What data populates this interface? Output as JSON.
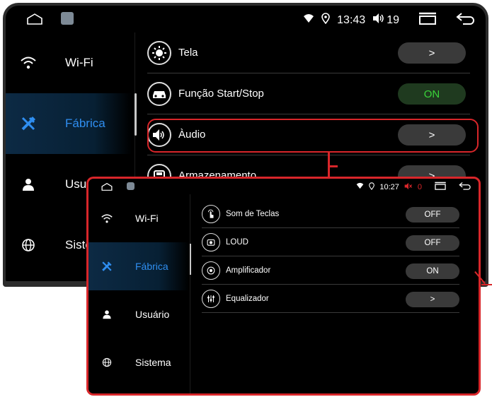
{
  "main": {
    "status": {
      "time": "13:43",
      "volume": "19"
    },
    "sidebar": [
      {
        "label": "Wi-Fi",
        "icon": "wifi-icon"
      },
      {
        "label": "Fábrica",
        "icon": "tools-icon",
        "active": true
      },
      {
        "label": "Usuário",
        "icon": "user-icon"
      },
      {
        "label": "Siste",
        "icon": "globe-icon"
      }
    ],
    "rows": [
      {
        "label": "Tela",
        "icon": "brightness-icon",
        "control": ">"
      },
      {
        "label": "Função Start/Stop",
        "icon": "car-icon",
        "control": "ON"
      },
      {
        "label": "Àudio",
        "icon": "speaker-icon",
        "control": ">"
      },
      {
        "label": "Armazenamento",
        "icon": "storage-icon",
        "control": ">"
      }
    ]
  },
  "zoom": {
    "status": {
      "time": "10:27",
      "volume": "0"
    },
    "sidebar": [
      {
        "label": "Wi-Fi",
        "icon": "wifi-icon"
      },
      {
        "label": "Fábrica",
        "icon": "tools-icon",
        "active": true
      },
      {
        "label": "Usuário",
        "icon": "user-icon"
      },
      {
        "label": "Sistema",
        "icon": "globe-icon"
      }
    ],
    "rows": [
      {
        "label": "Som de Teclas",
        "icon": "touch-icon",
        "control": "OFF"
      },
      {
        "label": "LOUD",
        "icon": "loud-icon",
        "control": "OFF"
      },
      {
        "label": "Amplificador",
        "icon": "amplifier-icon",
        "control": "ON"
      },
      {
        "label": "Equalizador",
        "icon": "equalizer-icon",
        "control": ">"
      }
    ]
  },
  "colors": {
    "accent": "#2f8ef0",
    "highlight": "#d8262a",
    "on_text": "#3ad43a"
  }
}
